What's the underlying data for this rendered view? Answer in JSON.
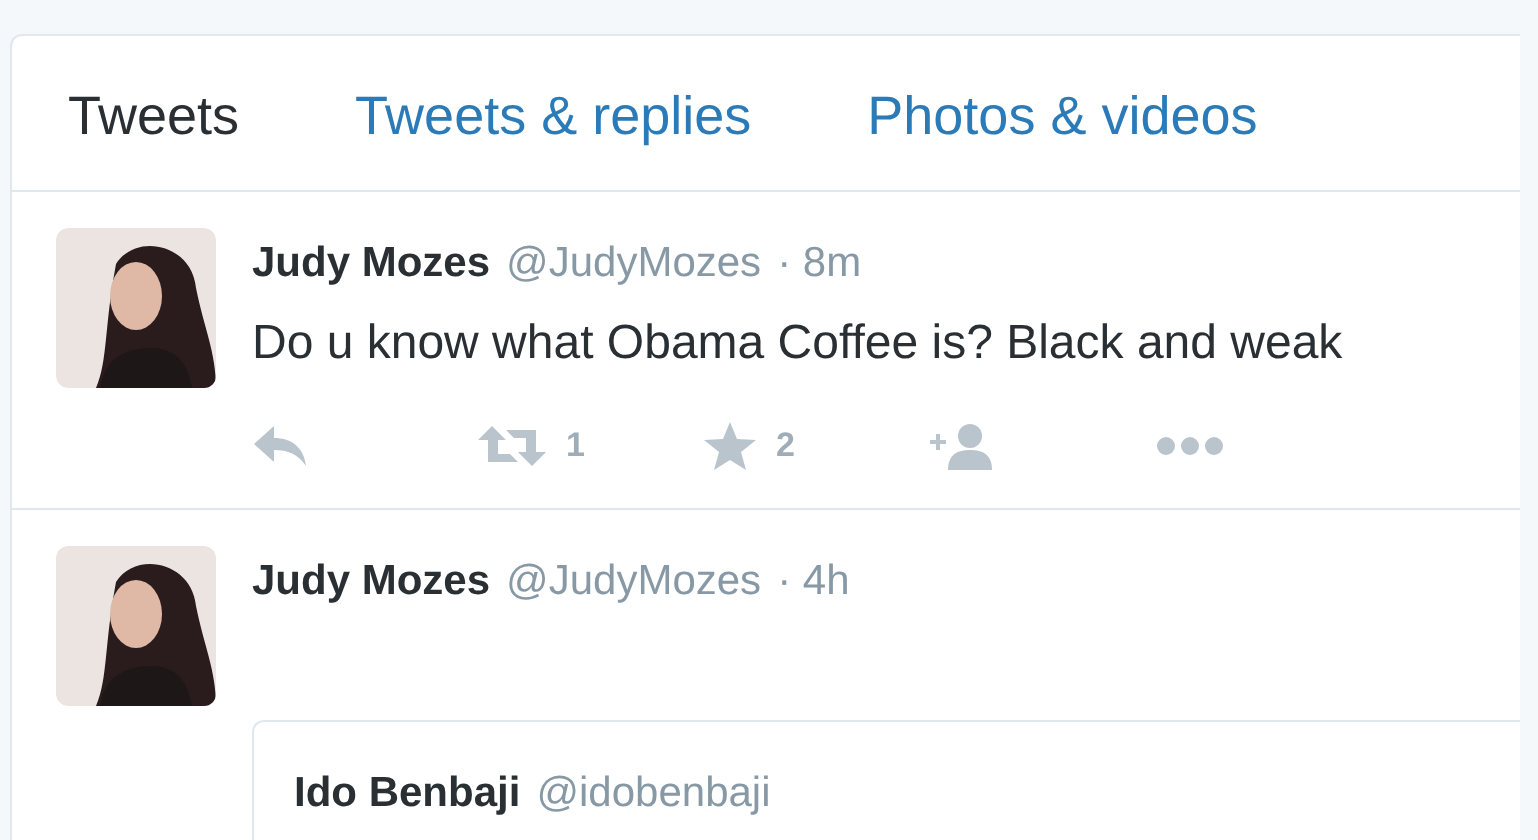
{
  "tabs": [
    {
      "label": "Tweets",
      "selected": true
    },
    {
      "label": "Tweets & replies",
      "selected": false
    },
    {
      "label": "Photos & videos",
      "selected": false
    }
  ],
  "tweets": [
    {
      "name": "Judy Mozes",
      "handle": "@JudyMozes",
      "time": "· 8m",
      "text": "Do u know what Obama Coffee is? Black and weak",
      "actions": [
        {
          "kind": "reply"
        },
        {
          "kind": "retweet",
          "count": "1"
        },
        {
          "kind": "favorite",
          "count": "2"
        },
        {
          "kind": "follow"
        },
        {
          "kind": "more"
        }
      ]
    },
    {
      "name": "Judy Mozes",
      "handle": "@JudyMozes",
      "time": "· 4h",
      "quote": {
        "name": "Ido Benbaji",
        "handle": "@idobenbaji"
      }
    }
  ]
}
